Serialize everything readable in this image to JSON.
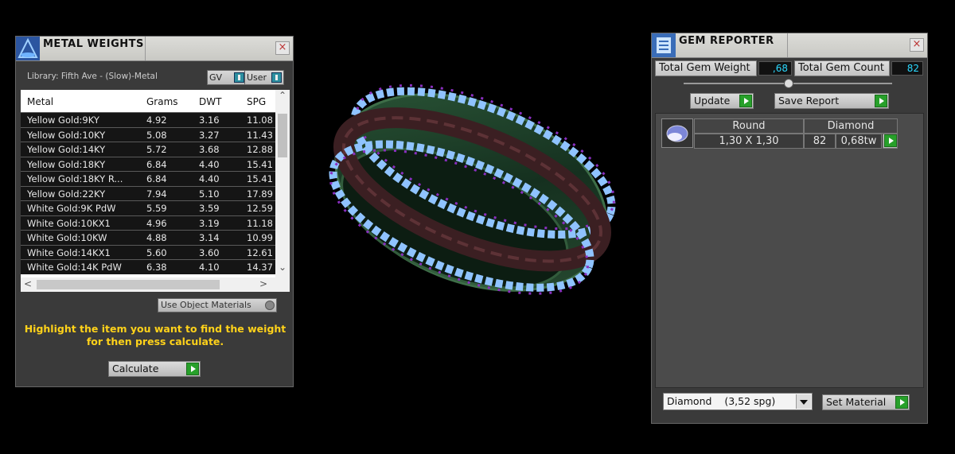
{
  "metal_weights": {
    "title": "METAL WEIGHTS",
    "close": "×",
    "library": "Library: Fifth Ave - (Slow)-Metal",
    "toggle_gv": "GV",
    "toggle_user": "User",
    "columns": [
      "Metal",
      "Grams",
      "DWT",
      "SPG"
    ],
    "rows": [
      [
        "Yellow Gold:9KY",
        "4.92",
        "3.16",
        "11.08"
      ],
      [
        "Yellow Gold:10KY",
        "5.08",
        "3.27",
        "11.43"
      ],
      [
        "Yellow Gold:14KY",
        "5.72",
        "3.68",
        "12.88"
      ],
      [
        "Yellow Gold:18KY",
        "6.84",
        "4.40",
        "15.41"
      ],
      [
        "Yellow Gold:18KY R...",
        "6.84",
        "4.40",
        "15.41"
      ],
      [
        "Yellow Gold:22KY",
        "7.94",
        "5.10",
        "17.89"
      ],
      [
        "White Gold:9K PdW",
        "5.59",
        "3.59",
        "12.59"
      ],
      [
        "White Gold:10KX1",
        "4.96",
        "3.19",
        "11.18"
      ],
      [
        "White Gold:10KW",
        "4.88",
        "3.14",
        "10.99"
      ],
      [
        "White Gold:14KX1",
        "5.60",
        "3.60",
        "12.61"
      ],
      [
        "White Gold:14K PdW",
        "6.38",
        "4.10",
        "14.37"
      ]
    ],
    "use_object_materials": "Use Object Materials",
    "hint_line1": "Highlight the item you want to find the weight",
    "hint_line2": "for then press calculate.",
    "calculate": "Calculate"
  },
  "gem_reporter": {
    "title": "GEM REPORTER",
    "close": "×",
    "total_weight_label": "Total Gem Weight",
    "total_weight_value": ",68",
    "total_count_label": "Total Gem Count",
    "total_count_value": "82",
    "update": "Update",
    "save_report": "Save Report",
    "gems": [
      {
        "shape": "Round",
        "material": "Diamond",
        "size": "1,30 X 1,30",
        "count": "82",
        "weight": "0,68tw"
      }
    ],
    "material_select": "Diamond    (3,52 spg)",
    "set_material": "Set Material"
  },
  "colors": {
    "accent_cyan": "#2bd9ff",
    "hint_yellow": "#ffd21a",
    "go_green": "#27a02a"
  }
}
